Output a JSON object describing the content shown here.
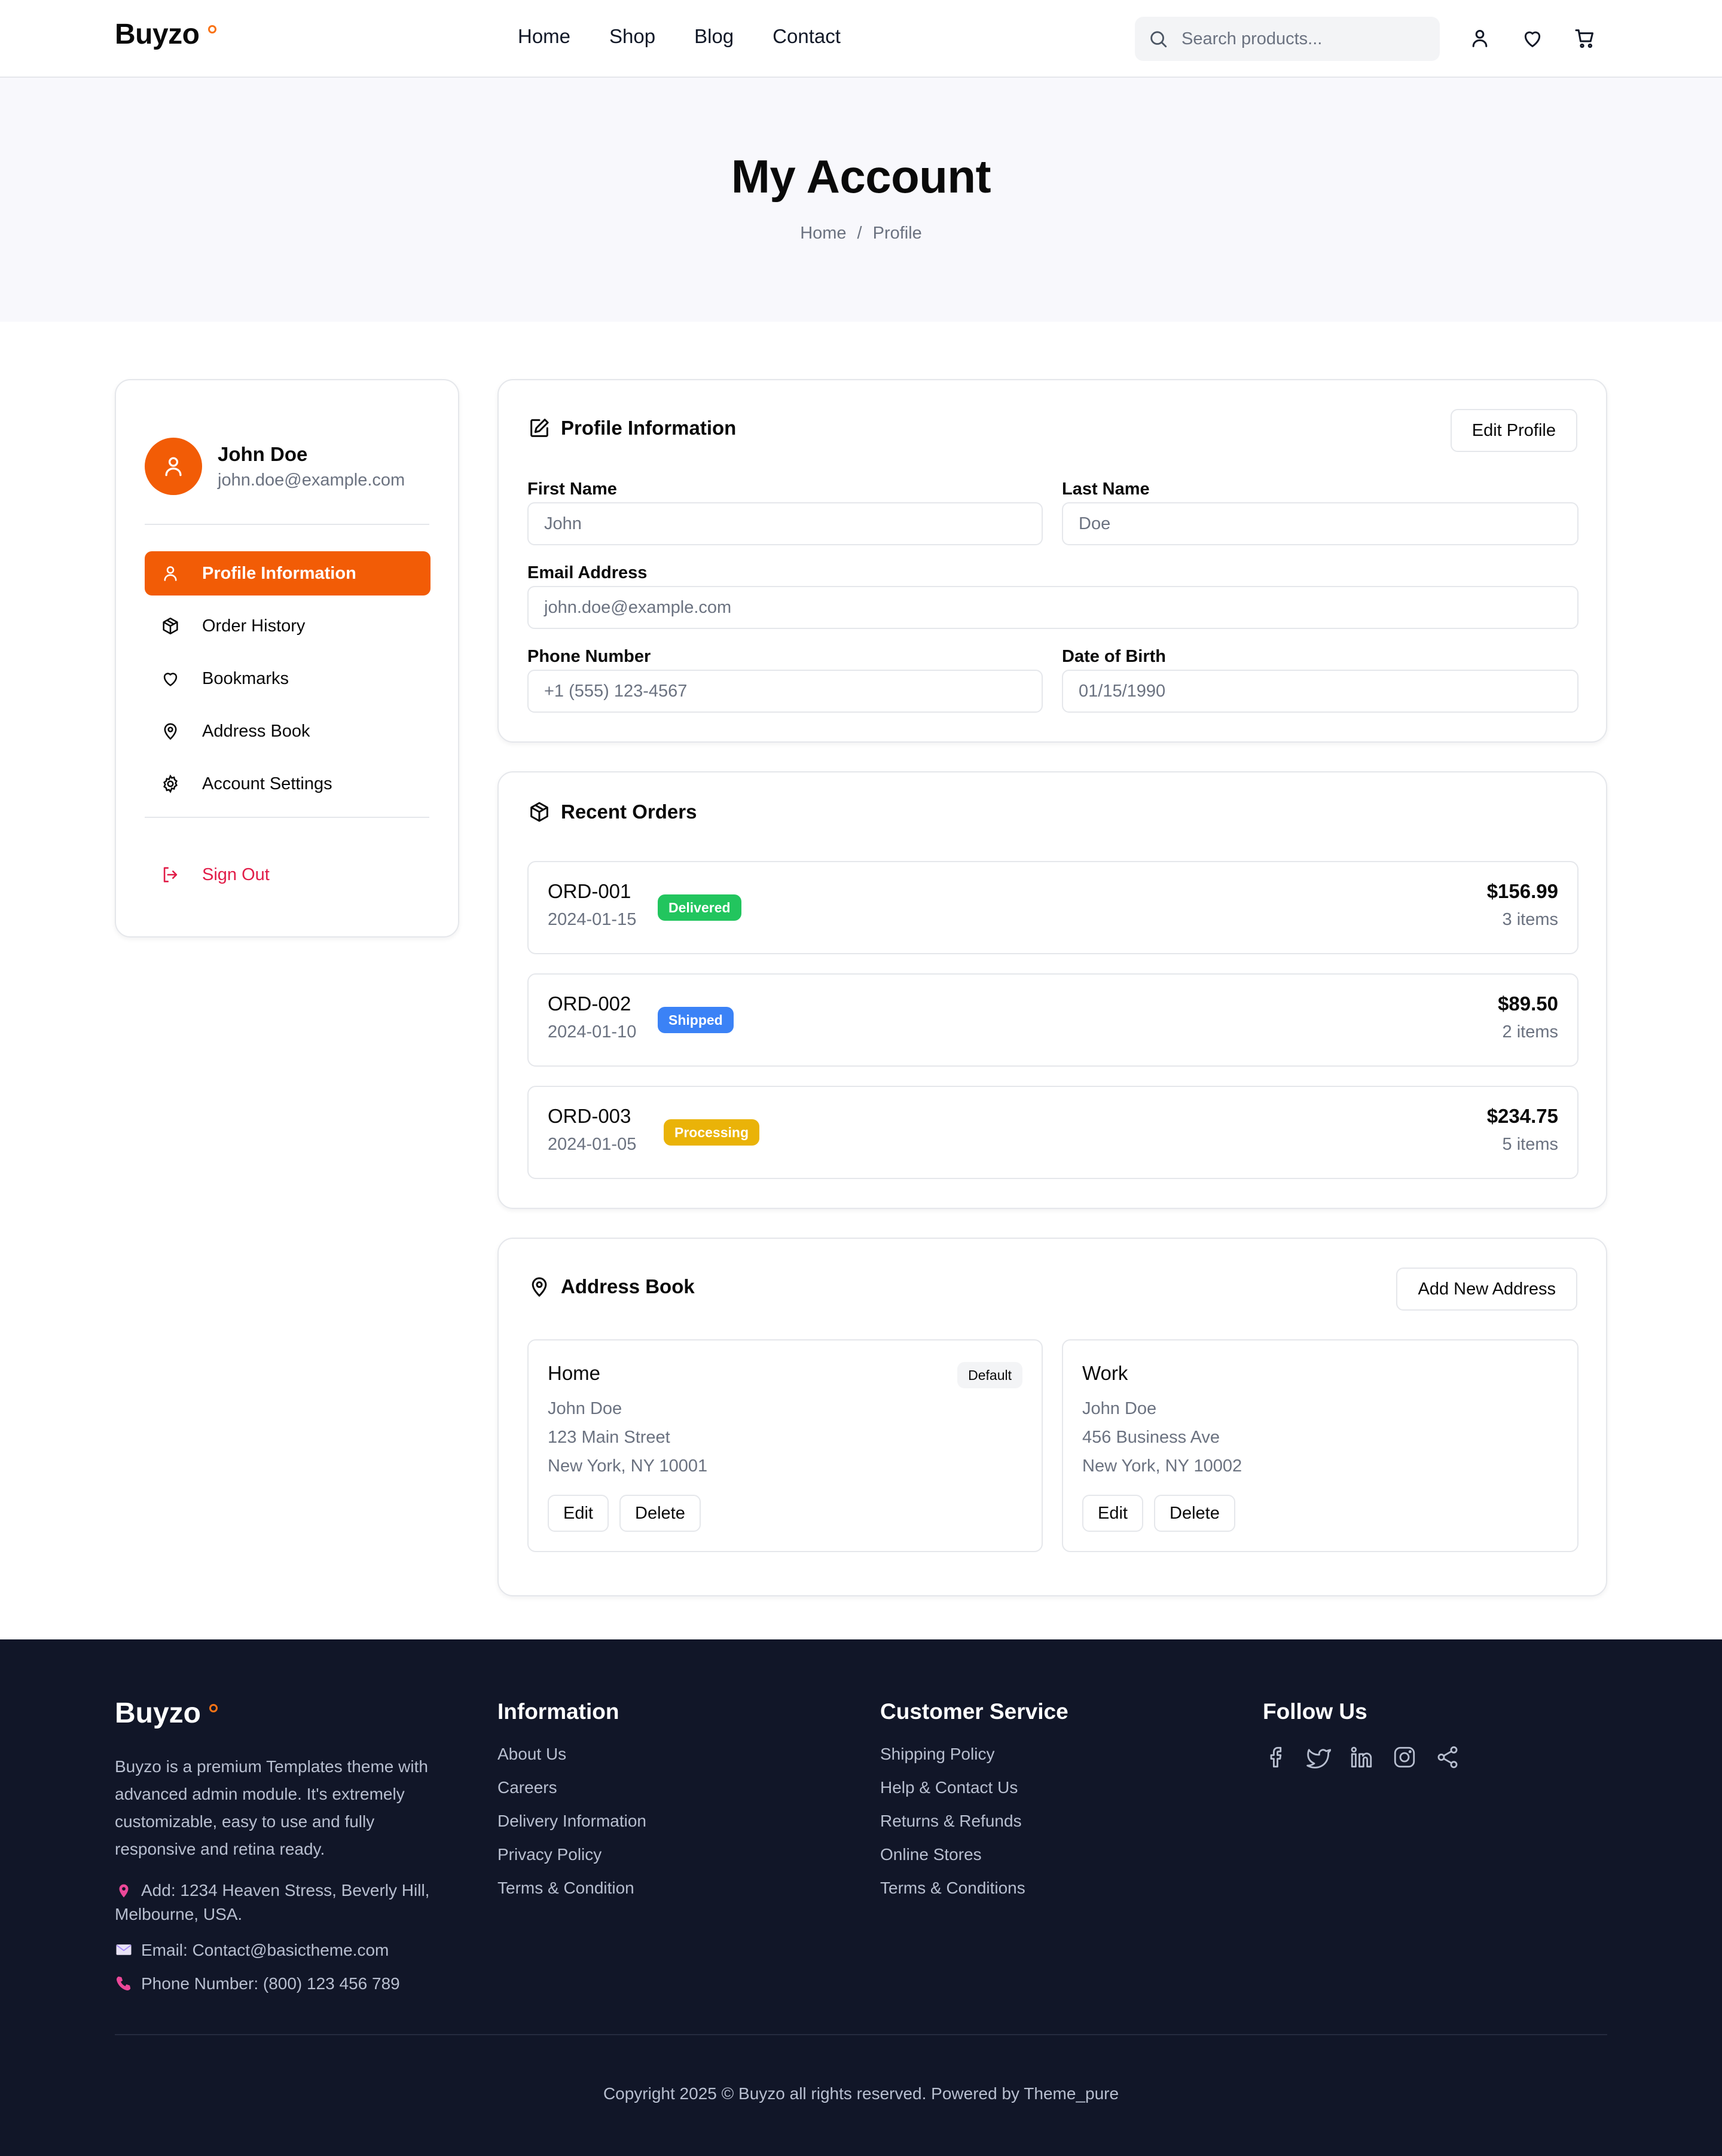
{
  "brand": {
    "name": "Buyzo",
    "accent": "#f25c06"
  },
  "nav": {
    "items": [
      "Home",
      "Shop",
      "Blog",
      "Contact"
    ]
  },
  "search": {
    "placeholder": "Search products..."
  },
  "header_icons": [
    "user-icon",
    "heart-icon",
    "cart-icon"
  ],
  "hero": {
    "title": "My Account",
    "breadcrumb": [
      "Home",
      "Profile"
    ],
    "separator": "/"
  },
  "user": {
    "name": "John Doe",
    "email": "john.doe@example.com"
  },
  "sidebar": {
    "items": [
      {
        "label": "Profile Information",
        "icon": "user-icon",
        "active": true
      },
      {
        "label": "Order History",
        "icon": "package-icon",
        "active": false
      },
      {
        "label": "Bookmarks",
        "icon": "heart-icon",
        "active": false
      },
      {
        "label": "Address Book",
        "icon": "map-pin-icon",
        "active": false
      },
      {
        "label": "Account Settings",
        "icon": "gear-icon",
        "active": false
      }
    ],
    "sign_out": "Sign Out"
  },
  "profile": {
    "title": "Profile Information",
    "edit_label": "Edit Profile",
    "fields": {
      "first_name": {
        "label": "First Name",
        "value": "John"
      },
      "last_name": {
        "label": "Last Name",
        "value": "Doe"
      },
      "email": {
        "label": "Email Address",
        "value": "john.doe@example.com"
      },
      "phone": {
        "label": "Phone Number",
        "value": "+1 (555) 123-4567"
      },
      "dob": {
        "label": "Date of Birth",
        "value": "01/15/1990"
      }
    }
  },
  "orders": {
    "title": "Recent Orders",
    "items": [
      {
        "id": "ORD-001",
        "date": "2024-01-15",
        "status": "Delivered",
        "status_color": "#22c55e",
        "total": "$156.99",
        "count": "3 items"
      },
      {
        "id": "ORD-002",
        "date": "2024-01-10",
        "status": "Shipped",
        "status_color": "#3b82f6",
        "total": "$89.50",
        "count": "2 items"
      },
      {
        "id": "ORD-003",
        "date": "2024-01-05",
        "status": "Processing",
        "status_color": "#eab308",
        "total": "$234.75",
        "count": "5 items"
      }
    ]
  },
  "address_book": {
    "title": "Address Book",
    "add_label": "Add New Address",
    "edit_label": "Edit",
    "delete_label": "Delete",
    "default_label": "Default",
    "items": [
      {
        "name": "Home",
        "recipient": "John Doe",
        "street": "123 Main Street",
        "city": "New York, NY 10001",
        "is_default": true
      },
      {
        "name": "Work",
        "recipient": "John Doe",
        "street": "456 Business Ave",
        "city": "New York, NY 10002",
        "is_default": false
      }
    ]
  },
  "footer": {
    "brand": "Buyzo",
    "description": "Buyzo is a premium Templates theme with advanced admin module. It's extremely customizable, easy to use and fully responsive and retina ready.",
    "address": "Add: 1234 Heaven Stress, Beverly Hill, Melbourne, USA.",
    "email": "Email: Contact@basictheme.com",
    "phone": "Phone Number: (800) 123 456 789",
    "columns": [
      {
        "title": "Information",
        "links": [
          "About Us",
          "Careers",
          "Delivery Information",
          "Privacy Policy",
          "Terms & Condition"
        ]
      },
      {
        "title": "Customer Service",
        "links": [
          "Shipping Policy",
          "Help & Contact Us",
          "Returns & Refunds",
          "Online Stores",
          "Terms & Conditions"
        ]
      }
    ],
    "follow": {
      "title": "Follow Us",
      "icons": [
        "facebook-icon",
        "twitter-icon",
        "linkedin-icon",
        "instagram-icon",
        "share-icon"
      ]
    },
    "copyright": "Copyright 2025 © Buyzo all rights reserved. Powered by Theme_pure",
    "background": "#111628"
  }
}
